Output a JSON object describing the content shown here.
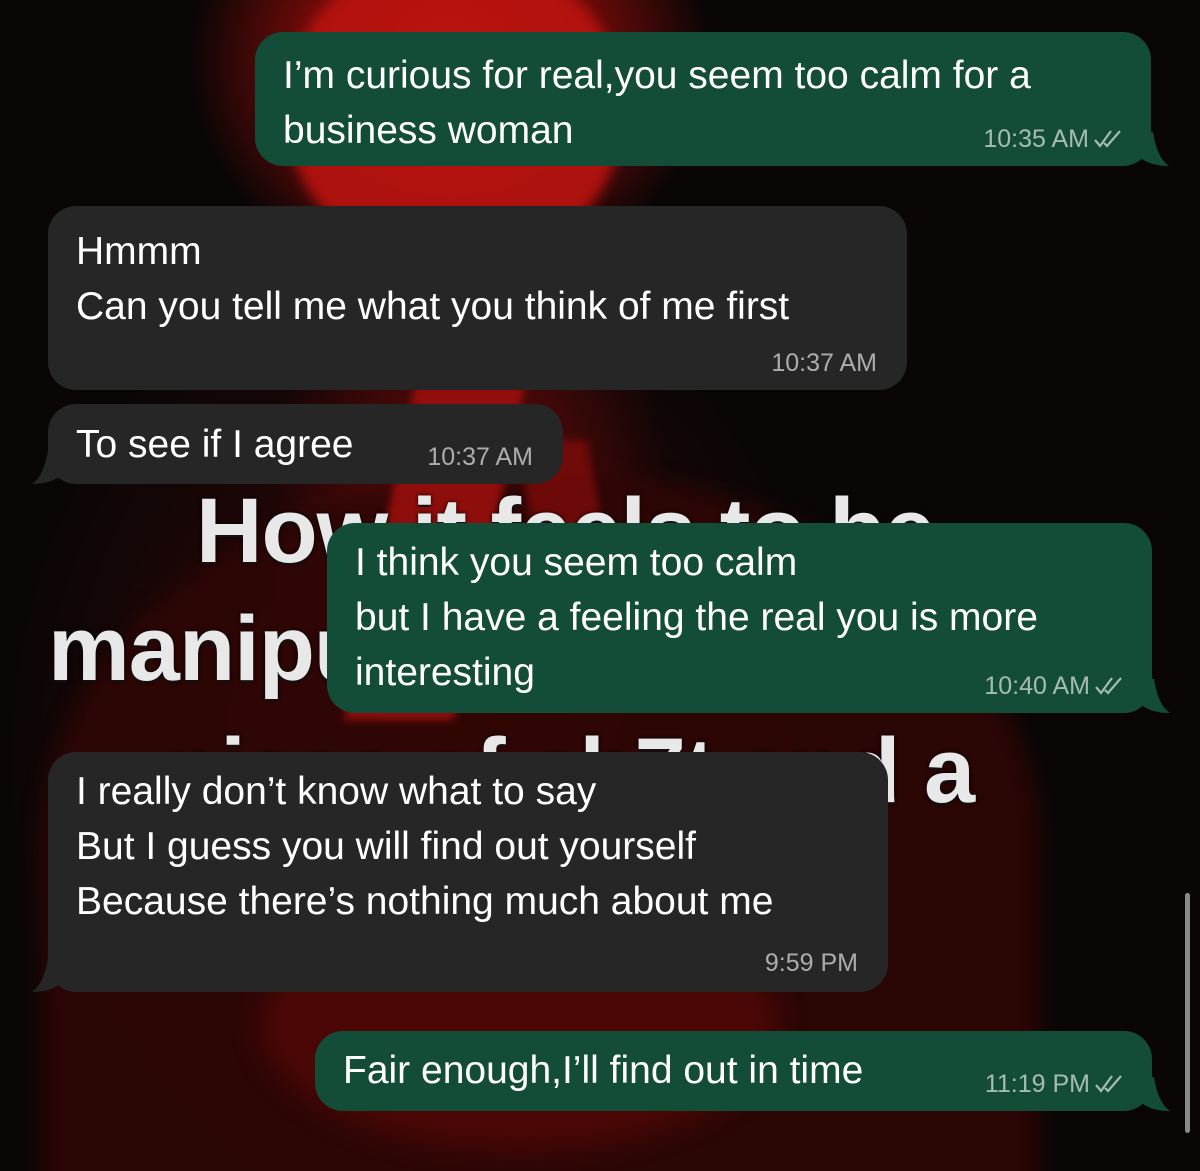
{
  "conversation": {
    "wallpaper": {
      "caption_line1": "How it feels to be",
      "caption_line2": "manipu",
      "caption_line3": "piece of sh7t and a"
    },
    "messages": [
      {
        "direction": "outgoing",
        "text": "I’m curious for real,you seem too calm for a\nbusiness woman",
        "time": "10:35 AM",
        "status": "read"
      },
      {
        "direction": "incoming",
        "text": "Hmmm\nCan you tell me what you think of me first",
        "time": "10:37 AM"
      },
      {
        "direction": "incoming",
        "text": "To see if I agree",
        "time": "10:37 AM"
      },
      {
        "direction": "outgoing",
        "text": "I think you seem too calm\nbut I have a feeling the real you is more\ninteresting",
        "time": "10:40 AM",
        "status": "read"
      },
      {
        "direction": "incoming",
        "text": "I really don’t know what to say\nBut I guess you will find out yourself\nBecause there’s nothing much about me",
        "time": "9:59 PM"
      },
      {
        "direction": "outgoing",
        "text": "Fair enough,I’ll find out in time",
        "time": "11:19 PM",
        "status": "read"
      }
    ]
  },
  "colors": {
    "outgoing_bubble": "#134d37",
    "incoming_bubble": "#262626",
    "wallpaper_red": "#b8130f"
  },
  "icons": {
    "read_receipt": "double-check-icon"
  }
}
